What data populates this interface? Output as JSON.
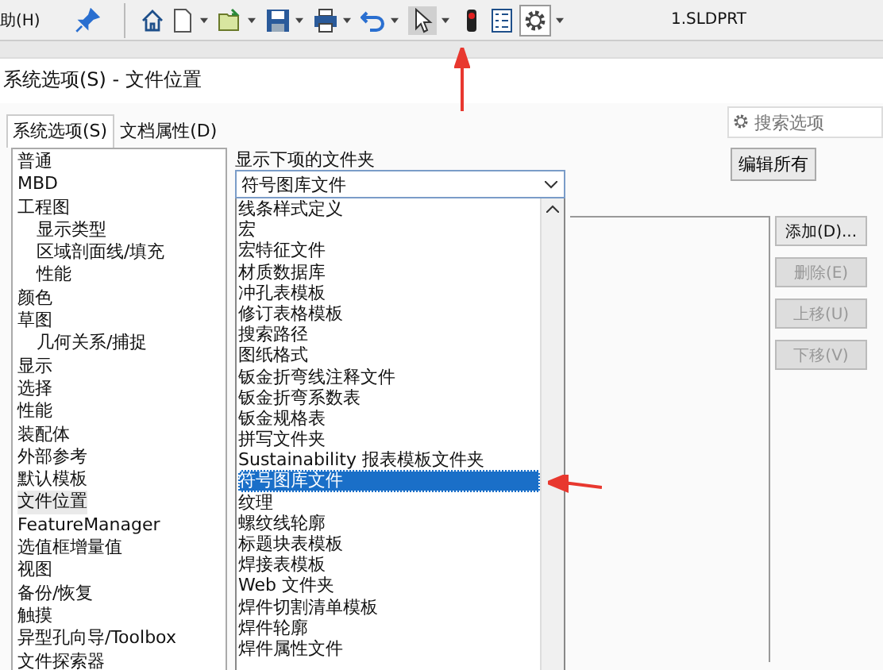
{
  "toolbar": {
    "help_menu": "助(H)",
    "document_title": "1.SLDPRT"
  },
  "dialog": {
    "title": "系统选项(S) - 文件位置"
  },
  "tabs": [
    {
      "label": "系统选项(S)",
      "selected": true
    },
    {
      "label": "文档属性(D)",
      "selected": false
    }
  ],
  "search": {
    "placeholder": "搜索选项"
  },
  "tree": [
    {
      "label": "普通",
      "selected": false
    },
    {
      "label": "MBD",
      "selected": false
    },
    {
      "label": "工程图",
      "selected": false,
      "children": [
        {
          "label": "显示类型",
          "selected": false
        },
        {
          "label": "区域剖面线/填充",
          "selected": false
        },
        {
          "label": "性能",
          "selected": false
        }
      ]
    },
    {
      "label": "颜色",
      "selected": false
    },
    {
      "label": "草图",
      "selected": false,
      "children": [
        {
          "label": "几何关系/捕捉",
          "selected": false
        }
      ]
    },
    {
      "label": "显示",
      "selected": false
    },
    {
      "label": "选择",
      "selected": false
    },
    {
      "label": "性能",
      "selected": false
    },
    {
      "label": "装配体",
      "selected": false
    },
    {
      "label": "外部参考",
      "selected": false
    },
    {
      "label": "默认模板",
      "selected": false
    },
    {
      "label": "文件位置",
      "selected": true
    },
    {
      "label": "FeatureManager",
      "selected": false
    },
    {
      "label": "选值框增量值",
      "selected": false
    },
    {
      "label": "视图",
      "selected": false
    },
    {
      "label": "备份/恢复",
      "selected": false
    },
    {
      "label": "触摸",
      "selected": false
    },
    {
      "label": "异型孔向导/Toolbox",
      "selected": false
    },
    {
      "label": "文件探索器",
      "selected": false
    }
  ],
  "folder_label": "显示下项的文件夹",
  "folder_select": {
    "value": "符号图库文件"
  },
  "dropdown_options": [
    {
      "label": "线条样式定义",
      "selected": false
    },
    {
      "label": "宏",
      "selected": false
    },
    {
      "label": "宏特征文件",
      "selected": false
    },
    {
      "label": "材质数据库",
      "selected": false
    },
    {
      "label": "冲孔表模板",
      "selected": false
    },
    {
      "label": "修订表格模板",
      "selected": false
    },
    {
      "label": "搜索路径",
      "selected": false
    },
    {
      "label": "图纸格式",
      "selected": false
    },
    {
      "label": "钣金折弯线注释文件",
      "selected": false
    },
    {
      "label": "钣金折弯系数表",
      "selected": false
    },
    {
      "label": "钣金规格表",
      "selected": false
    },
    {
      "label": "拼写文件夹",
      "selected": false
    },
    {
      "label": "Sustainability 报表模板文件夹",
      "selected": false
    },
    {
      "label": "符号图库文件",
      "selected": true
    },
    {
      "label": "纹理",
      "selected": false
    },
    {
      "label": "螺纹线轮廓",
      "selected": false
    },
    {
      "label": "标题块表模板",
      "selected": false
    },
    {
      "label": "焊接表模板",
      "selected": false
    },
    {
      "label": "Web 文件夹",
      "selected": false
    },
    {
      "label": "焊件切割清单模板",
      "selected": false
    },
    {
      "label": "焊件轮廓",
      "selected": false
    },
    {
      "label": "焊件属性文件",
      "selected": false
    }
  ],
  "edit_all_button": "编辑所有",
  "side_buttons": [
    {
      "label": "添加(D)...",
      "disabled": false
    },
    {
      "label": "删除(E)",
      "disabled": true
    },
    {
      "label": "上移(U)",
      "disabled": true
    },
    {
      "label": "下移(V)",
      "disabled": true
    }
  ]
}
